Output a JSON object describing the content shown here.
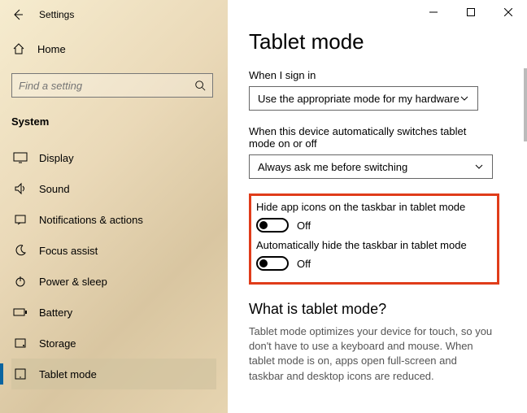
{
  "app": {
    "title": "Settings"
  },
  "sidebar": {
    "home": "Home",
    "search_placeholder": "Find a setting",
    "category": "System",
    "items": [
      {
        "label": "Display"
      },
      {
        "label": "Sound"
      },
      {
        "label": "Notifications & actions"
      },
      {
        "label": "Focus assist"
      },
      {
        "label": "Power & sleep"
      },
      {
        "label": "Battery"
      },
      {
        "label": "Storage"
      },
      {
        "label": "Tablet mode"
      }
    ]
  },
  "main": {
    "title": "Tablet mode",
    "signin_label": "When I sign in",
    "signin_value": "Use the appropriate mode for my hardware",
    "auto_label": "When this device automatically switches tablet mode on or off",
    "auto_value": "Always ask me before switching",
    "toggle1_label": "Hide app icons on the taskbar in tablet mode",
    "toggle1_value": "Off",
    "toggle2_label": "Automatically hide the taskbar in tablet mode",
    "toggle2_value": "Off",
    "what_head": "What is tablet mode?",
    "what_desc": "Tablet mode optimizes your device for touch, so you don't have to use a keyboard and mouse. When tablet mode is on, apps open full-screen and taskbar and desktop icons are reduced."
  }
}
